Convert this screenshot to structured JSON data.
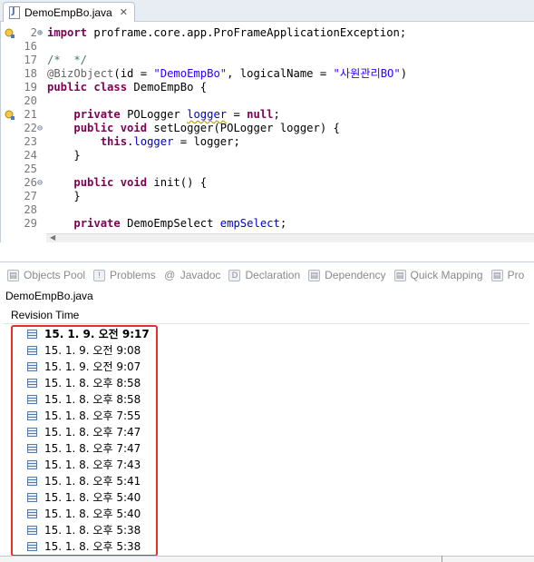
{
  "editor": {
    "tab_title": "DemoEmpBo.java",
    "lines": [
      {
        "num": "2",
        "mark": "⊕",
        "warn": true,
        "parts": [
          {
            "t": "import",
            "c": "kw"
          },
          {
            "t": " proframe.core.app.ProFrameApplicationException;",
            "c": ""
          }
        ]
      },
      {
        "num": "16",
        "mark": "",
        "warn": false,
        "parts": []
      },
      {
        "num": "17",
        "mark": "",
        "warn": false,
        "parts": [
          {
            "t": "/*  */",
            "c": "cm"
          }
        ]
      },
      {
        "num": "18",
        "mark": "",
        "warn": false,
        "parts": [
          {
            "t": "@BizObject",
            "c": "ann"
          },
          {
            "t": "(id = ",
            "c": ""
          },
          {
            "t": "\"DemoEmpBo\"",
            "c": "str"
          },
          {
            "t": ", logicalName = ",
            "c": ""
          },
          {
            "t": "\"사원관리BO\"",
            "c": "str"
          },
          {
            "t": ")",
            "c": ""
          }
        ]
      },
      {
        "num": "19",
        "mark": "",
        "warn": false,
        "parts": [
          {
            "t": "public class",
            "c": "kw"
          },
          {
            "t": " DemoEmpBo {",
            "c": ""
          }
        ]
      },
      {
        "num": "20",
        "mark": "",
        "warn": false,
        "parts": []
      },
      {
        "num": "21",
        "mark": "",
        "warn": true,
        "parts": [
          {
            "t": "    ",
            "c": ""
          },
          {
            "t": "private",
            "c": "kw"
          },
          {
            "t": " POLogger ",
            "c": ""
          },
          {
            "t": "logger",
            "c": "fld warnline"
          },
          {
            "t": " = ",
            "c": ""
          },
          {
            "t": "null",
            "c": "kw"
          },
          {
            "t": ";",
            "c": ""
          }
        ]
      },
      {
        "num": "22",
        "mark": "⊖",
        "warn": false,
        "parts": [
          {
            "t": "    ",
            "c": ""
          },
          {
            "t": "public void",
            "c": "kw"
          },
          {
            "t": " setLogger(POLogger logger) {",
            "c": ""
          }
        ]
      },
      {
        "num": "23",
        "mark": "",
        "warn": false,
        "parts": [
          {
            "t": "        ",
            "c": ""
          },
          {
            "t": "this",
            "c": "kw"
          },
          {
            "t": ".",
            "c": ""
          },
          {
            "t": "logger",
            "c": "fld"
          },
          {
            "t": " = logger;",
            "c": ""
          }
        ]
      },
      {
        "num": "24",
        "mark": "",
        "warn": false,
        "parts": [
          {
            "t": "    }",
            "c": ""
          }
        ]
      },
      {
        "num": "25",
        "mark": "",
        "warn": false,
        "parts": []
      },
      {
        "num": "26",
        "mark": "⊖",
        "warn": false,
        "parts": [
          {
            "t": "    ",
            "c": ""
          },
          {
            "t": "public void",
            "c": "kw"
          },
          {
            "t": " init() {",
            "c": ""
          }
        ]
      },
      {
        "num": "27",
        "mark": "",
        "warn": false,
        "parts": [
          {
            "t": "    }",
            "c": ""
          }
        ]
      },
      {
        "num": "28",
        "mark": "",
        "warn": false,
        "parts": []
      },
      {
        "num": "29",
        "mark": "",
        "warn": false,
        "parts": [
          {
            "t": "    ",
            "c": ""
          },
          {
            "t": "private",
            "c": "kw"
          },
          {
            "t": " DemoEmpSelect ",
            "c": ""
          },
          {
            "t": "empSelect",
            "c": "fld"
          },
          {
            "t": ";",
            "c": ""
          }
        ]
      }
    ]
  },
  "views": {
    "tabs": [
      {
        "label": "Objects Pool",
        "icon": "objects-pool-icon",
        "glyph": "▤"
      },
      {
        "label": "Problems",
        "icon": "problems-icon",
        "glyph": "!"
      },
      {
        "label": "Javadoc",
        "icon": "javadoc-icon",
        "glyph": "@"
      },
      {
        "label": "Declaration",
        "icon": "declaration-icon",
        "glyph": "D"
      },
      {
        "label": "Dependency",
        "icon": "dependency-icon",
        "glyph": "▤"
      },
      {
        "label": "Quick Mapping",
        "icon": "quick-mapping-icon",
        "glyph": "▤"
      },
      {
        "label": "Pro",
        "icon": "pro-icon",
        "glyph": "▤"
      }
    ],
    "file_label": "DemoEmpBo.java",
    "column_header": "Revision Time",
    "revisions": [
      "15. 1. 9. 오전 9:17",
      "15. 1. 9. 오전 9:08",
      "15. 1. 9. 오전 9:07",
      "15. 1. 8. 오후 8:58",
      "15. 1. 8. 오후 8:58",
      "15. 1. 8. 오후 7:55",
      "15. 1. 8. 오후 7:47",
      "15. 1. 8. 오후 7:47",
      "15. 1. 8. 오후 7:43",
      "15. 1. 8. 오후 5:41",
      "15. 1. 8. 오후 5:40",
      "15. 1. 8. 오후 5:40",
      "15. 1. 8. 오후 5:38",
      "15. 1. 8. 오후 5:38"
    ],
    "highlight_color": "#e52f2f"
  }
}
